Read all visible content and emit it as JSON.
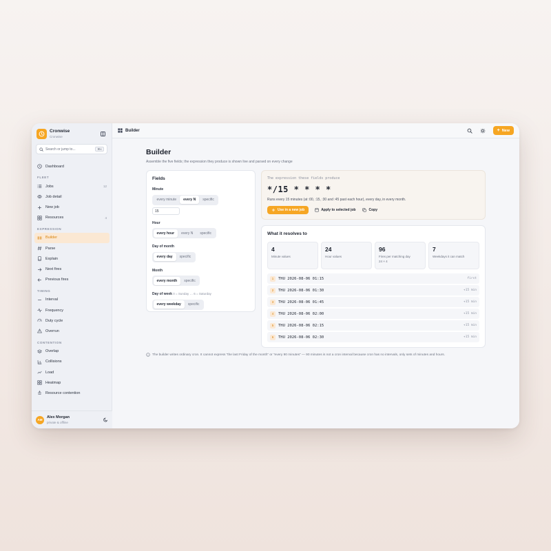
{
  "brand": {
    "name": "Cronwise",
    "sub": "Cronwise"
  },
  "search": {
    "placeholder": "Search or jump to...",
    "shortcut": "⌘K"
  },
  "nav": {
    "dashboard": "Dashboard",
    "sections": {
      "fleet": "FLEET",
      "expression": "EXPRESSION",
      "timing": "TIMING",
      "contention": "CONTENTION"
    },
    "fleet": [
      {
        "label": "Jobs",
        "count": "12"
      },
      {
        "label": "Job detail",
        "count": ""
      },
      {
        "label": "New job",
        "count": ""
      },
      {
        "label": "Resources",
        "count": "4"
      }
    ],
    "expression": [
      {
        "label": "Builder"
      },
      {
        "label": "Parse"
      },
      {
        "label": "Explain"
      },
      {
        "label": "Next fires"
      },
      {
        "label": "Previous fires"
      }
    ],
    "timing": [
      {
        "label": "Interval"
      },
      {
        "label": "Frequency"
      },
      {
        "label": "Duty cycle"
      },
      {
        "label": "Overrun"
      }
    ],
    "contention": [
      {
        "label": "Overlap"
      },
      {
        "label": "Collisions"
      },
      {
        "label": "Load"
      },
      {
        "label": "Heatmap"
      },
      {
        "label": "Resource contention"
      }
    ]
  },
  "user": {
    "initials": "AM",
    "name": "Alex Morgan",
    "status": "private & offline"
  },
  "topbar": {
    "crumb": "Builder",
    "new_label": "New"
  },
  "page": {
    "title": "Builder",
    "subtitle": "Assemble the five fields; the expression they produce is shown live and parsed on every change"
  },
  "fields": {
    "title": "Fields",
    "minute": {
      "label": "Minute",
      "options": [
        "every minute",
        "every N",
        "specific"
      ],
      "value": "15"
    },
    "hour": {
      "label": "Hour",
      "options": [
        "every hour",
        "every N",
        "specific"
      ]
    },
    "dom": {
      "label": "Day of month",
      "options": [
        "every day",
        "specific"
      ]
    },
    "month": {
      "label": "Month",
      "options": [
        "every month",
        "specific"
      ]
    },
    "dow": {
      "label": "Day of week",
      "hint": "0 = Sunday … 6 = Saturday",
      "options": [
        "every weekday",
        "specific"
      ]
    }
  },
  "expression": {
    "label": "The expression these fields produce",
    "value": "*/15 * * * *",
    "description": "Runs every 15 minutes (at :00, :15, :30 and :45 past each hour), every day, in every month.",
    "use_label": "Use in a new job",
    "apply_label": "Apply to selected job",
    "copy_label": "Copy"
  },
  "resolves": {
    "title": "What it resolves to",
    "stats": [
      {
        "num": "4",
        "label": "Minute values",
        "sub": ""
      },
      {
        "num": "24",
        "label": "Hour values",
        "sub": ""
      },
      {
        "num": "96",
        "label": "Fires per matching day",
        "sub": "24 × 4"
      },
      {
        "num": "7",
        "label": "Weekdays it can match",
        "sub": ""
      }
    ],
    "fires": [
      {
        "idx": "1",
        "time": "THU 2026-08-06 01:15",
        "delta": "first"
      },
      {
        "idx": "2",
        "time": "THU 2026-08-06 01:30",
        "delta": "+15 min"
      },
      {
        "idx": "3",
        "time": "THU 2026-08-06 01:45",
        "delta": "+15 min"
      },
      {
        "idx": "4",
        "time": "THU 2026-08-06 02:00",
        "delta": "+15 min"
      },
      {
        "idx": "5",
        "time": "THU 2026-08-06 02:15",
        "delta": "+15 min"
      },
      {
        "idx": "6",
        "time": "THU 2026-08-06 02:30",
        "delta": "+15 min"
      }
    ]
  },
  "footnote": "The builder writes ordinary cron. It cannot express “the last Friday of the month” or “every 90 minutes” — 90 minutes is not a cron interval because cron has no intervals, only sets of minutes and hours.",
  "colors": {
    "accent": "#f6a623",
    "active_bg": "#fbe8d3",
    "active_text": "#d98510"
  },
  "icons": {
    "brand": "clock-icon",
    "search": "search-icon",
    "theme": "sun-icon",
    "mode": "moon-icon",
    "info": "info-icon"
  }
}
